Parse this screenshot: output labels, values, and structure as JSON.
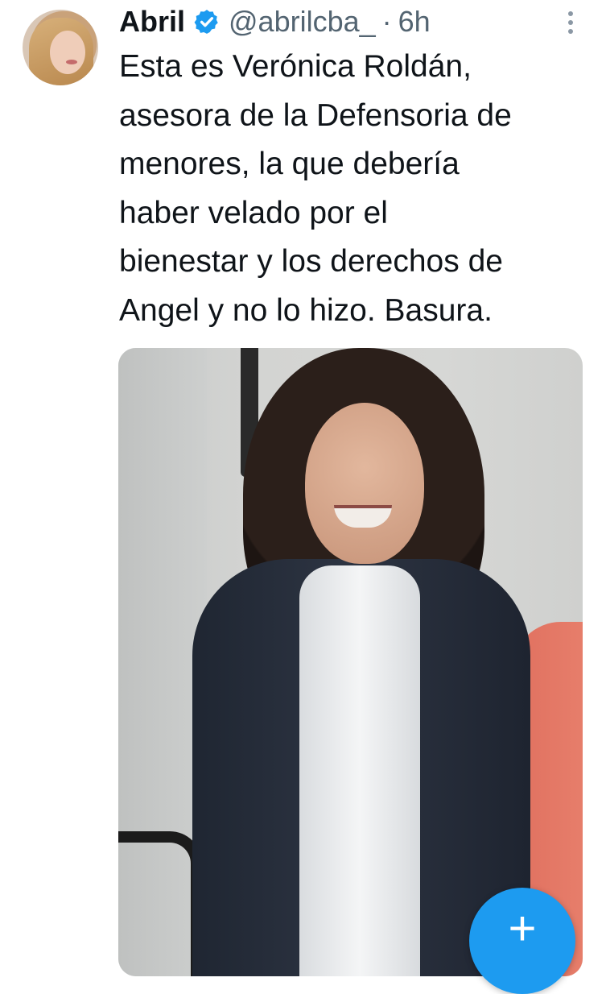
{
  "tweet": {
    "display_name": "Abril",
    "handle": "@abrilcba_",
    "separator": "·",
    "time": "6h",
    "text_lines": [
      "Esta es Verónica Roldán,",
      "asesora de la Defensoria de",
      "menores, la que debería",
      "haber velado por el",
      "bienestar y los derechos de",
      "Angel y no lo hizo. Basura."
    ]
  },
  "icons": {
    "verified": "verified-badge-icon",
    "more": "more-options-icon",
    "compose": "compose-plus-icon"
  },
  "fab": {
    "label": "+"
  },
  "colors": {
    "accent": "#1d9bf0",
    "text": "#0f1419",
    "secondary": "#536471"
  }
}
